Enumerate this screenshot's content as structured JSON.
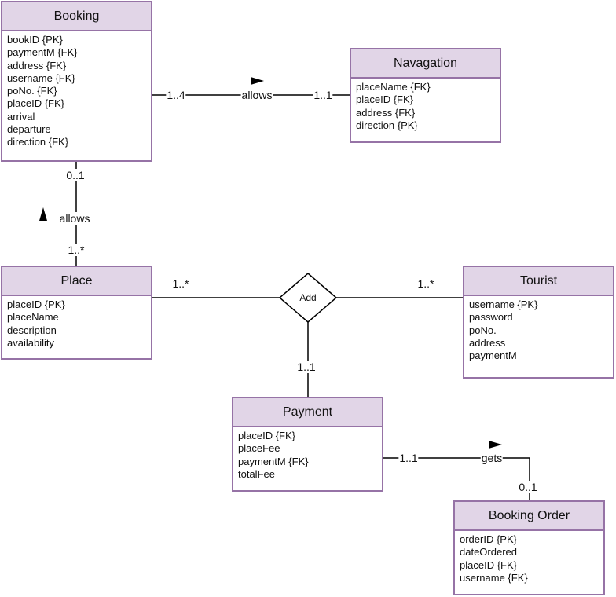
{
  "colors": {
    "entity_border": "#9673a6",
    "entity_header": "#e1d5e7",
    "line": "#000000"
  },
  "entities": [
    {
      "id": "booking",
      "title": "Booking",
      "attributes": [
        "bookID {PK}",
        "paymentM {FK}",
        "address {FK}",
        "username {FK}",
        "poNo. {FK}",
        "placeID {FK}",
        "arrival",
        "departure",
        "direction {FK}"
      ]
    },
    {
      "id": "navagation",
      "title": "Navagation",
      "attributes": [
        "placeName {FK}",
        "placeID {FK}",
        "address {FK}",
        "direction {PK}"
      ]
    },
    {
      "id": "place",
      "title": "Place",
      "attributes": [
        "placeID {PK}",
        "placeName",
        "description",
        "availability"
      ]
    },
    {
      "id": "tourist",
      "title": "Tourist",
      "attributes": [
        "username {PK}",
        "password",
        "poNo.",
        "address",
        "paymentM"
      ]
    },
    {
      "id": "payment",
      "title": "Payment",
      "attributes": [
        "placeID {FK}",
        "placeFee",
        "paymentM {FK}",
        "totalFee"
      ]
    },
    {
      "id": "booking-order",
      "title": "Booking Order",
      "attributes": [
        "orderID {PK}",
        "dateOrdered",
        "placeID {FK}",
        "username {FK}"
      ]
    }
  ],
  "relationships": {
    "booking_navagation": {
      "label": "allows",
      "card_from": "1..4",
      "card_to": "1..1",
      "arrow": "right"
    },
    "booking_place": {
      "label": "allows",
      "card_from": "0..1",
      "card_to": "1..*",
      "arrow": "up"
    },
    "add": {
      "label": "Add",
      "card_place": "1..*",
      "card_tourist": "1..*",
      "card_payment": "1..1"
    },
    "payment_order": {
      "label": "gets",
      "card_from": "1..1",
      "card_to": "0..1",
      "arrow": "right"
    }
  }
}
